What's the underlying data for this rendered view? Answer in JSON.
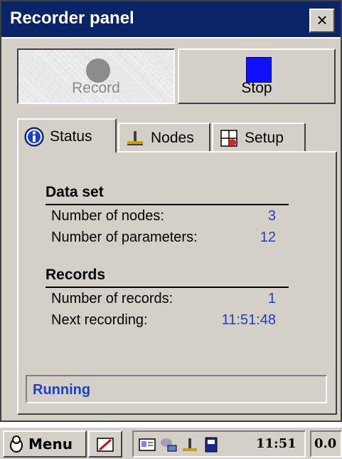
{
  "window": {
    "title": "Recorder panel",
    "close_label": "×"
  },
  "toolbar": {
    "record_label": "Record",
    "stop_label": "Stop",
    "record_enabled": false
  },
  "tabs": [
    {
      "label": "Status",
      "icon": "info-icon",
      "active": true
    },
    {
      "label": "Nodes",
      "icon": "nodes-icon",
      "active": false
    },
    {
      "label": "Setup",
      "icon": "setup-icon",
      "active": false
    }
  ],
  "status_panel": {
    "data_set": {
      "title": "Data set",
      "rows": [
        {
          "label": "Number of nodes:",
          "value": "3"
        },
        {
          "label": "Number of parameters:",
          "value": "12"
        }
      ]
    },
    "records": {
      "title": "Records",
      "rows": [
        {
          "label": "Number of records:",
          "value": "1"
        },
        {
          "label": "Next recording:",
          "value": "11:51:48"
        }
      ]
    },
    "state": "Running"
  },
  "taskbar": {
    "menu_label": "Menu",
    "time": "11:51",
    "extra": "0.0"
  },
  "colors": {
    "title_bg": "#0a246a",
    "value_text": "#1f3fc0",
    "stop_square": "#1010ff",
    "panel_bg": "#d4d0c8"
  }
}
